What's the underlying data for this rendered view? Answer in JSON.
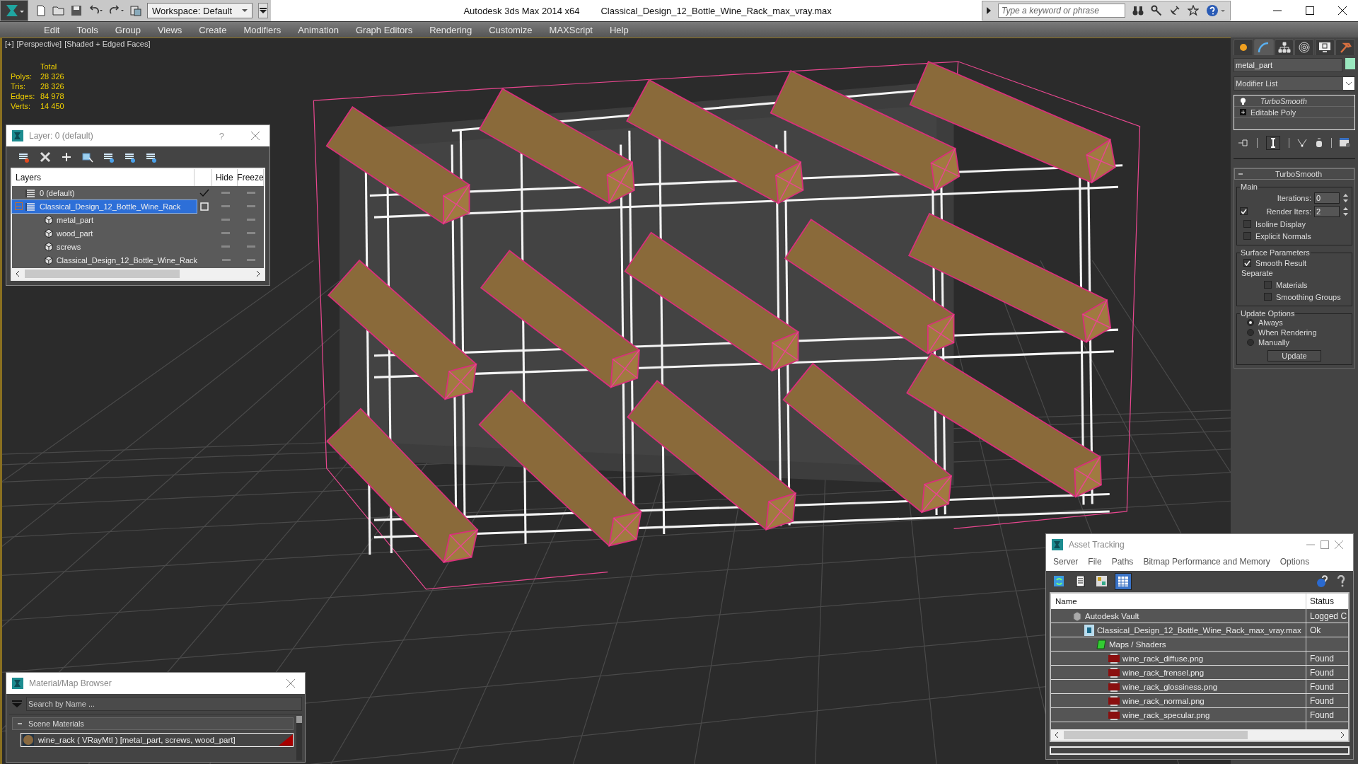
{
  "title_bar": {
    "workspace": "Workspace: Default",
    "app_title": "Autodesk 3ds Max  2014 x64",
    "file_title": "Classical_Design_12_Bottle_Wine_Rack_max_vray.max",
    "search": {
      "placeholder": "Type a keyword or phrase"
    }
  },
  "menu": [
    "Edit",
    "Tools",
    "Group",
    "Views",
    "Create",
    "Modifiers",
    "Animation",
    "Graph Editors",
    "Rendering",
    "Customize",
    "MAXScript",
    "Help"
  ],
  "viewport": {
    "labels": [
      "[+]",
      "[Perspective]",
      "[Shaded + Edged Faces]"
    ],
    "stats": {
      "header": "Total",
      "rows": [
        {
          "label": "Polys:",
          "value": "28 326"
        },
        {
          "label": "Tris:",
          "value": "28 326"
        },
        {
          "label": "Edges:",
          "value": "84 978"
        },
        {
          "label": "Verts:",
          "value": "14 450"
        }
      ]
    }
  },
  "layer_window": {
    "title": "Layer: 0 (default)",
    "help": "?",
    "columns": [
      "Layers",
      "Hide",
      "Freeze"
    ],
    "rows": [
      {
        "name": "0 (default)",
        "kind": "layer",
        "selected": false,
        "current": true
      },
      {
        "name": "Classical_Design_12_Bottle_Wine_Rack",
        "kind": "layer",
        "selected": true,
        "current": false,
        "expanded": true,
        "children": [
          {
            "name": "metal_part",
            "kind": "object",
            "selected": false
          },
          {
            "name": "wood_part",
            "kind": "object",
            "selected": false
          },
          {
            "name": "screws",
            "kind": "object",
            "selected": false
          },
          {
            "name": "Classical_Design_12_Bottle_Wine_Rack",
            "kind": "object",
            "selected": false
          }
        ]
      }
    ]
  },
  "command_panel": {
    "tabs": [
      {
        "selected": false
      },
      {
        "selected": true
      },
      {
        "selected": false
      },
      {
        "selected": false
      },
      {
        "selected": false
      },
      {
        "selected": false
      }
    ],
    "object_name": "metal_part",
    "modifier_list": "Modifier List",
    "stack": [
      {
        "name": "TurboSmooth",
        "kind": "modifier"
      },
      {
        "name": "Editable Poly",
        "kind": "base"
      }
    ],
    "rollout": {
      "title": "TurboSmooth",
      "expanded": true,
      "groups": [
        {
          "title": "Main",
          "items": [
            {
              "kind": "spinner",
              "label": "Iterations:",
              "value": "0"
            },
            {
              "kind": "spinner",
              "label": "Render Iters:",
              "value": "2",
              "checked": true
            },
            {
              "kind": "check",
              "label": "Isoline Display",
              "checked": false
            },
            {
              "kind": "check",
              "label": "Explicit Normals",
              "checked": false
            }
          ]
        },
        {
          "title": "Surface Parameters",
          "items": [
            {
              "kind": "check",
              "label": "Smooth Result",
              "checked": true
            },
            {
              "kind": "label",
              "label": "Separate"
            },
            {
              "kind": "subcheck",
              "label": "Materials",
              "checked": false
            },
            {
              "kind": "subcheck",
              "label": "Smoothing Groups",
              "checked": false
            }
          ]
        },
        {
          "title": "Update Options",
          "items": [
            {
              "kind": "radio",
              "label": "Always",
              "selected": true
            },
            {
              "kind": "radio",
              "label": "When Rendering",
              "selected": false
            },
            {
              "kind": "radio",
              "label": "Manually",
              "selected": false
            },
            {
              "kind": "button",
              "label": "Update"
            }
          ]
        }
      ]
    }
  },
  "asset_tracking": {
    "title": "Asset Tracking",
    "menu": [
      "Server",
      "File",
      "Paths",
      "Bitmap Performance and Memory",
      "Options"
    ],
    "toolbar": [
      {
        "selected": false
      },
      {
        "selected": false
      },
      {
        "selected": false
      },
      {
        "selected": true
      }
    ],
    "columns": [
      "Name",
      "Status"
    ],
    "rows": [
      {
        "name": "Autodesk Vault",
        "status": "Logged C",
        "kind": "vault",
        "children": [
          {
            "name": "Classical_Design_12_Bottle_Wine_Rack_max_vray.max",
            "status": "Ok",
            "kind": "scene",
            "children": [
              {
                "name": "Maps / Shaders",
                "kind": "folder",
                "children": [
                  {
                    "name": "wine_rack_diffuse.png",
                    "status": "Found",
                    "kind": "png"
                  },
                  {
                    "name": "wine_rack_frensel.png",
                    "status": "Found",
                    "kind": "png"
                  },
                  {
                    "name": "wine_rack_glossiness.png",
                    "status": "Found",
                    "kind": "png"
                  },
                  {
                    "name": "wine_rack_normal.png",
                    "status": "Found",
                    "kind": "png"
                  },
                  {
                    "name": "wine_rack_specular.png",
                    "status": "Found",
                    "kind": "png"
                  }
                ]
              }
            ]
          }
        ]
      }
    ]
  },
  "material_browser": {
    "title": "Material/Map Browser",
    "search": {
      "placeholder": "Search by Name ..."
    },
    "groups": [
      {
        "title": "Scene Materials",
        "expanded": true,
        "items": [
          {
            "name": "wine_rack  ( VRayMtl )  [metal_part, screws, wood_part]",
            "selected": true
          }
        ]
      }
    ]
  }
}
